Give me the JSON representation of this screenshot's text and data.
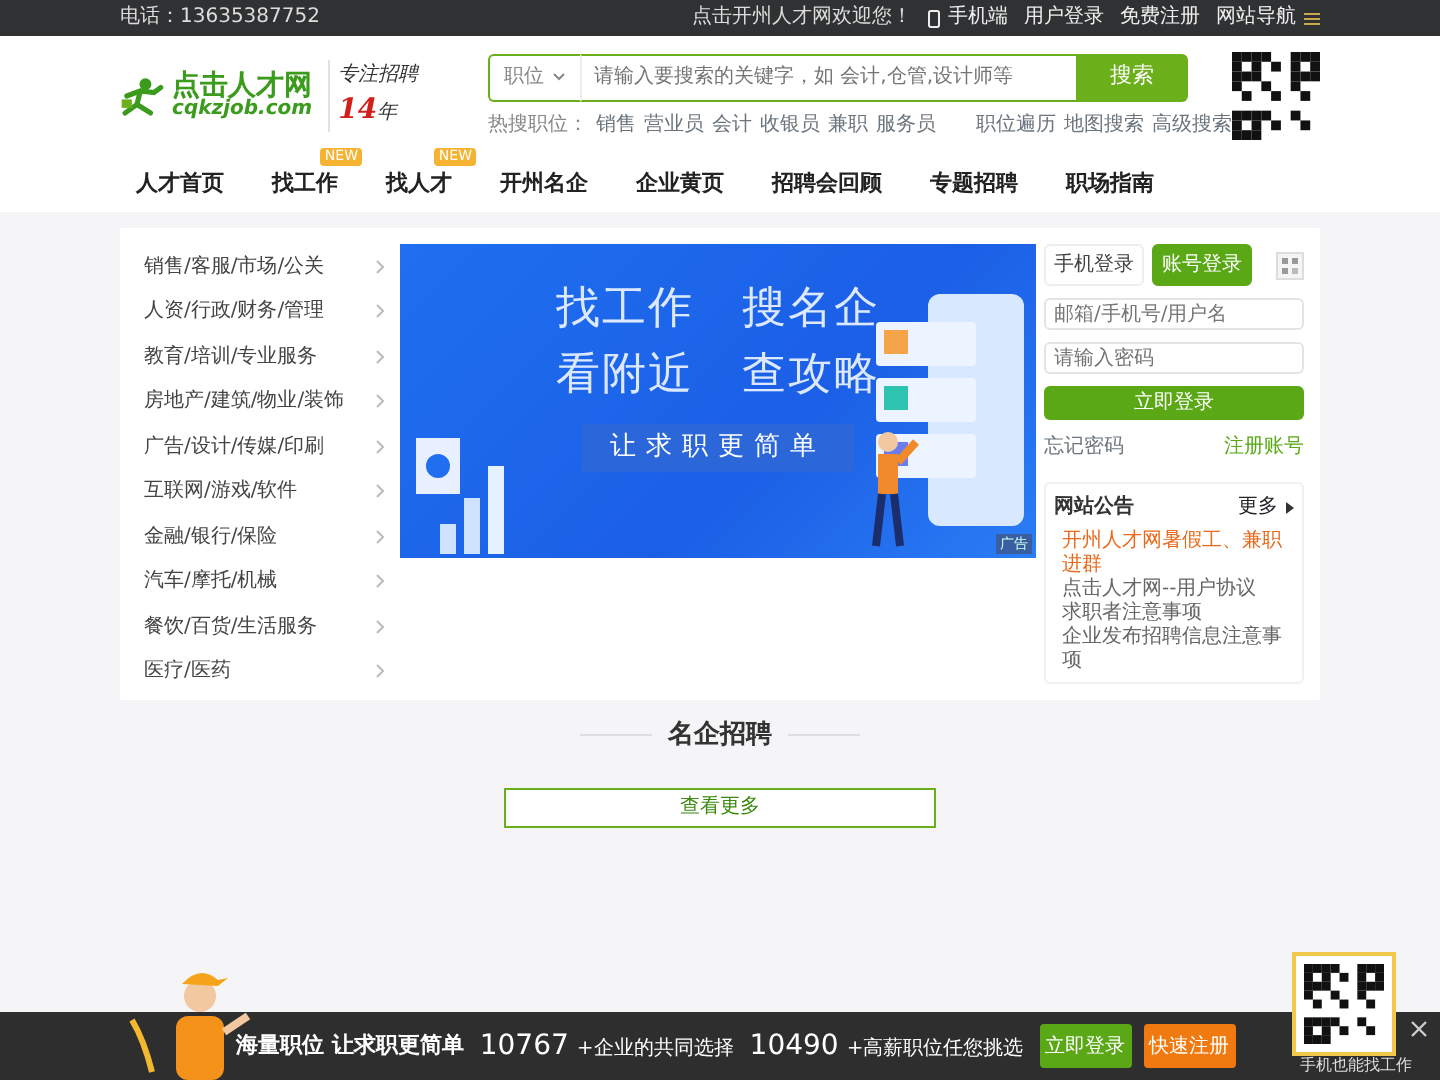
{
  "top_bar": {
    "phone": "电话：13635387752",
    "welcome": "点击开州人才网欢迎您！",
    "links": [
      {
        "label": "手机端",
        "kind": "mobile"
      },
      {
        "label": "用户登录",
        "kind": "plain"
      },
      {
        "label": "免费注册",
        "kind": "plain"
      },
      {
        "label": "网站导航",
        "kind": "menu"
      }
    ]
  },
  "header": {
    "logo": {
      "name": "点击人才网",
      "domain": "cqkzjob.com",
      "slogan": "专注招聘",
      "years": "14",
      "unit": "年"
    },
    "search": {
      "category": "职位",
      "placeholder": "请输入要搜索的关键字，如 会计,仓管,设计师等",
      "button": "搜索",
      "hot_label": "热搜职位：",
      "hot_terms": [
        "销售",
        "营业员",
        "会计",
        "收银员",
        "兼职",
        "服务员"
      ],
      "links": [
        "职位遍历",
        "地图搜索",
        "高级搜索"
      ]
    }
  },
  "nav": [
    {
      "label": "人才首页"
    },
    {
      "label": "找工作",
      "badge": "NEW"
    },
    {
      "label": "找人才",
      "badge": "NEW"
    },
    {
      "label": "开州名企"
    },
    {
      "label": "企业黄页"
    },
    {
      "label": "招聘会回顾"
    },
    {
      "label": "专题招聘"
    },
    {
      "label": "职场指南"
    }
  ],
  "categories": [
    "销售/客服/市场/公关",
    "人资/行政/财务/管理",
    "教育/培训/专业服务",
    "房地产/建筑/物业/装饰",
    "广告/设计/传媒/印刷",
    "互联网/游戏/软件",
    "金融/银行/保险",
    "汽车/摩托/机械",
    "餐饮/百货/生活服务",
    "医疗/医药"
  ],
  "banner": {
    "lines": [
      [
        "找工作",
        "搜名企"
      ],
      [
        "看附近",
        "查攻略"
      ]
    ],
    "tagline": "让求职更简单",
    "ad_label": "广告"
  },
  "login": {
    "tabs": [
      {
        "label": "手机登录",
        "selected": false
      },
      {
        "label": "账号登录",
        "selected": true
      }
    ],
    "username_placeholder": "邮箱/手机号/用户名",
    "password_placeholder": "请输入密码",
    "submit": "立即登录",
    "forgot": "忘记密码",
    "register": "注册账号"
  },
  "notices": {
    "title": "网站公告",
    "more": "更多",
    "items": [
      {
        "text": "开州人才网暑假工、兼职进群",
        "highlighted": true
      },
      {
        "text": "点击人才网--用户协议",
        "highlighted": false
      },
      {
        "text": "求职者注意事项",
        "highlighted": false
      },
      {
        "text": "企业发布招聘信息注意事项",
        "highlighted": false
      }
    ]
  },
  "section": {
    "title": "名企招聘",
    "more_button": "查看更多"
  },
  "bottom_bar": {
    "headline": "海量职位 让求职更简单",
    "stats": [
      {
        "number": "10767",
        "caption": "+企业的共同选择"
      },
      {
        "number": "10490",
        "caption": "+高薪职位任您挑选"
      }
    ],
    "buttons": [
      {
        "label": "立即登录",
        "kind": "primary"
      },
      {
        "label": "快速注册",
        "kind": "secondary"
      }
    ],
    "qr_caption": "手机也能找工作"
  }
}
